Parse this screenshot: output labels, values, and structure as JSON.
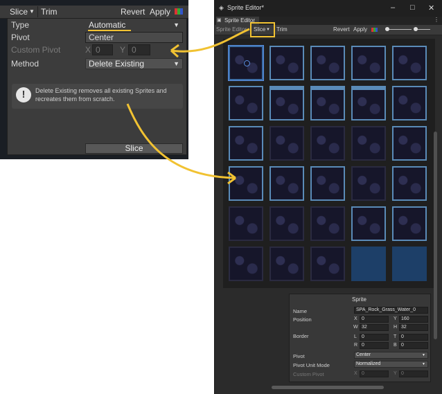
{
  "popup": {
    "toolbar": {
      "slice": "Slice",
      "trim": "Trim",
      "revert": "Revert",
      "apply": "Apply"
    },
    "type": {
      "label": "Type",
      "value": "Automatic"
    },
    "pivot": {
      "label": "Pivot",
      "value": "Center"
    },
    "custom_pivot": {
      "label": "Custom Pivot",
      "x_label": "X",
      "x_value": "0",
      "y_label": "Y",
      "y_value": "0"
    },
    "method": {
      "label": "Method",
      "value": "Delete Existing"
    },
    "info": {
      "icon": "!",
      "text": "Delete Existing removes all existing Sprites and recreates them from scratch."
    },
    "slice_button": "Slice"
  },
  "window": {
    "title": "Sprite Editor*",
    "controls": {
      "minimize": "–",
      "maximize": "□",
      "close": "✕",
      "more": "⋮"
    },
    "tab": "Sprite Editor",
    "toolbar": {
      "mode": "Sprite Editor",
      "slice": "Slice",
      "trim": "Trim",
      "revert": "Revert",
      "apply": "Apply"
    },
    "inspector": {
      "header": "Sprite",
      "name_label": "Name",
      "name_value": "SPA_Rock_Grass_Water_0",
      "position_label": "Position",
      "x": "0",
      "y": "160",
      "w": "32",
      "h": "32",
      "border_label": "Border",
      "l": "0",
      "t": "0",
      "r": "0",
      "b": "0",
      "pivot_label": "Pivot",
      "pivot_value": "Center",
      "pivot_unit_label": "Pivot Unit Mode",
      "pivot_unit_value": "Normalized",
      "custom_pivot_label": "Custom Pivot",
      "cp_x": "0",
      "cp_y": "0"
    }
  },
  "colors": {
    "highlight": "#f1c232",
    "panel": "#3c3c3c",
    "canvas": "#1f1f1f"
  }
}
